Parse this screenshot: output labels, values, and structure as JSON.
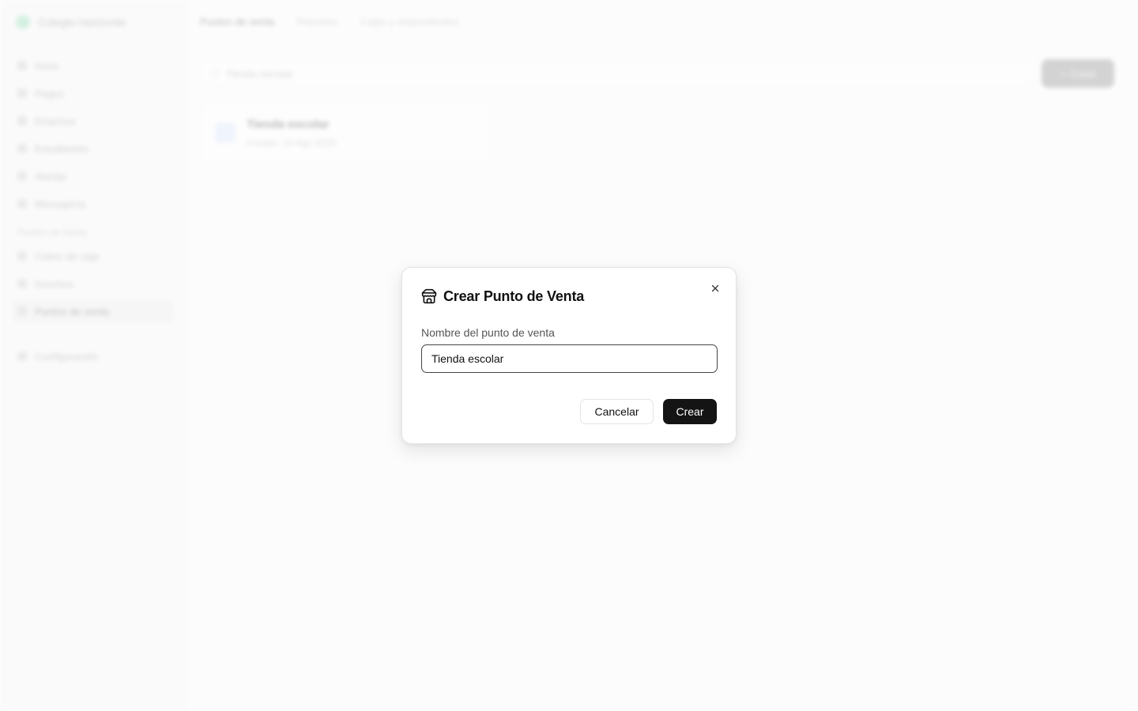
{
  "sidebar": {
    "brand": "Colegio Horizonte",
    "items": [
      {
        "label": "Inicio"
      },
      {
        "label": "Pagos"
      },
      {
        "label": "Emprese"
      },
      {
        "label": "Estudiantes"
      },
      {
        "label": "Alertas"
      },
      {
        "label": "Mensajería"
      }
    ],
    "section_label": "Puntos de Venta",
    "section_items": [
      {
        "label": "Cobro de caja"
      },
      {
        "label": "Insumos"
      },
      {
        "label": "Puntos de venta"
      }
    ],
    "settings_label": "Configuración"
  },
  "main": {
    "tabs": [
      "Puntos de venta",
      "Reportes",
      "Cajas y dependientes"
    ],
    "search_placeholder": "Tienda escolar",
    "add_button": "Crear",
    "card": {
      "title": "Tienda escolar",
      "subtitle": "Creado: 10 Ago 2025"
    }
  },
  "modal": {
    "title": "Crear Punto de Venta",
    "field_label": "Nombre del punto de venta",
    "field_value": "Tienda escolar",
    "cancel_label": "Cancelar",
    "create_label": "Crear",
    "icons": {
      "title": "store-icon",
      "close": "close-icon"
    }
  }
}
